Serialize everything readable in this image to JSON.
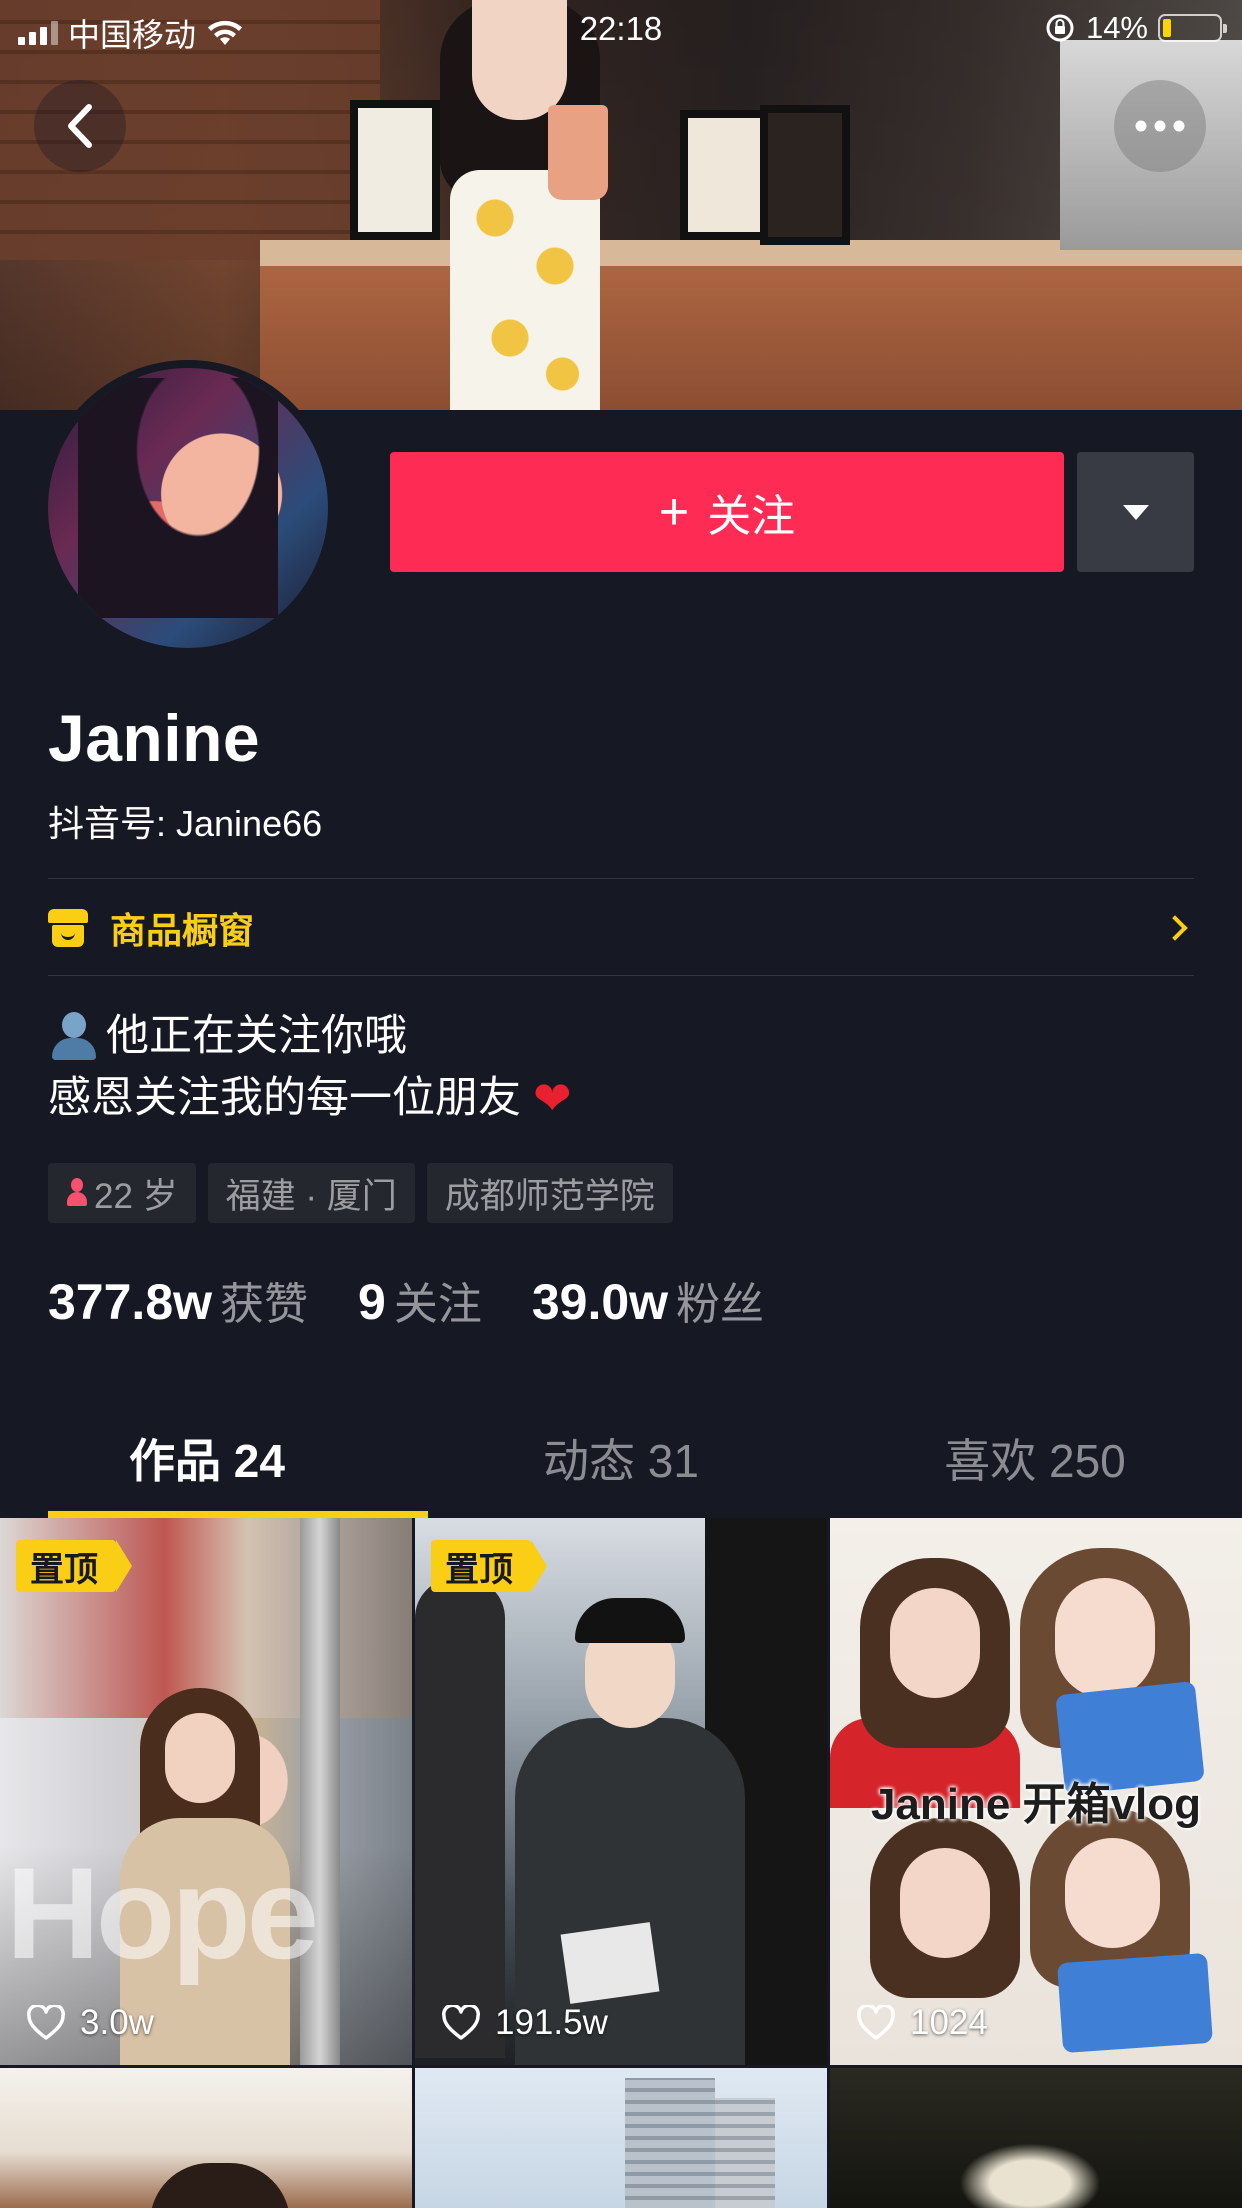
{
  "status_bar": {
    "carrier": "中国移动",
    "time": "22:18",
    "battery_percent": "14%",
    "battery_level": 0.14
  },
  "profile": {
    "nickname": "Janine",
    "douyin_id": "抖音号: Janine66",
    "follow_button": "关注",
    "shop_window": "商品橱窗",
    "bio_line1": "他正在关注你哦",
    "bio_line2": "感恩关注我的每一位朋友",
    "tags": {
      "age": "22 岁",
      "location": "福建 · 厦门",
      "school": "成都师范学院"
    },
    "stats": {
      "likes": {
        "value": "377.8w",
        "label": "获赞"
      },
      "following": {
        "value": "9",
        "label": "关注"
      },
      "followers": {
        "value": "39.0w",
        "label": "粉丝"
      }
    }
  },
  "tabs": [
    {
      "label": "作品 24",
      "active": true
    },
    {
      "label": "动态 31",
      "active": false
    },
    {
      "label": "喜欢 250",
      "active": false
    }
  ],
  "videos": [
    {
      "pinned": "置顶",
      "likes": "3.0w",
      "overlay": "Hope"
    },
    {
      "pinned": "置顶",
      "likes": "191.5w"
    },
    {
      "likes": "1024",
      "overlay": "Janine 开箱vlog"
    }
  ],
  "colors": {
    "background": "#161823",
    "follow_red": "#fe2c55",
    "accent_yellow": "#face15"
  },
  "icons": {
    "back": "chevron-left-icon",
    "more": "more-dots-icon",
    "dropdown": "caret-down-icon",
    "shop": "shop-icon",
    "heart": "heart-outline-icon"
  }
}
